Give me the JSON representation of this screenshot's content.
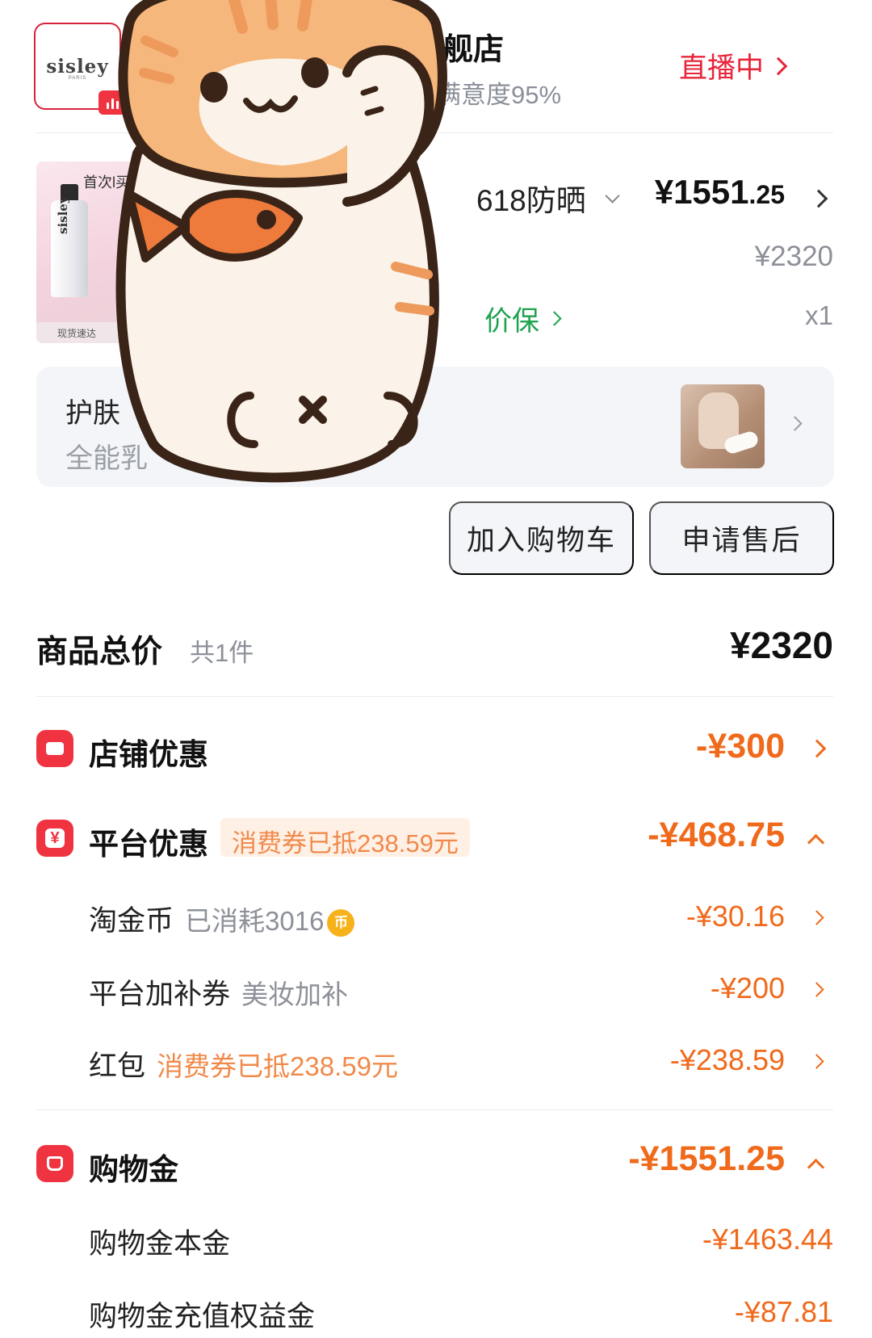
{
  "store": {
    "logo_text": "sisley",
    "logo_sub": "PARIS",
    "name": "旗舰店",
    "satisfaction": "满意度95%",
    "live_label": "直播中"
  },
  "product": {
    "thumb_brand": "sisley",
    "thumb_tag": "首次l买",
    "thumb_foot": "现货速达",
    "title": "618防晒",
    "price_main": "¥1551",
    "price_decimal": ".25",
    "original_price": "¥2320",
    "price_protect": "价保",
    "quantity": "x1"
  },
  "tip": {
    "title": "护肤",
    "subtitle": "全能乳"
  },
  "actions": {
    "add_to_cart": "加入购物车",
    "after_sale": "申请售后"
  },
  "summary": {
    "label": "商品总价",
    "count": "共1件",
    "value": "¥2320"
  },
  "store_discount": {
    "label": "店铺优惠",
    "value": "-¥300"
  },
  "platform_discount": {
    "label": "平台优惠",
    "coupon_tag": "消费券已抵238.59元",
    "value": "-¥468.75",
    "items": [
      {
        "label": "淘金币",
        "note": "已消耗3016",
        "coin_icon": "币",
        "value": "-¥30.16"
      },
      {
        "label": "平台加补券",
        "note": "美妆加补",
        "value": "-¥200"
      },
      {
        "label": "红包",
        "note": "消费券已抵238.59元",
        "value": "-¥238.59"
      }
    ]
  },
  "shopping_credit": {
    "label": "购物金",
    "value": "-¥1551.25",
    "items": [
      {
        "label": "购物金本金",
        "value": "-¥1463.44"
      },
      {
        "label": "购物金充值权益金",
        "value": "-¥87.81"
      }
    ]
  },
  "colors": {
    "brand_red": "#ef3340",
    "discount_orange": "#f06a1c",
    "price_protect_green": "#1ea34f"
  },
  "icons": {
    "store": "storefront-icon",
    "platform": "coupon-icon",
    "credit": "shopping-bag-icon",
    "coin": "coin-icon",
    "sticker": "cat-sticker"
  }
}
